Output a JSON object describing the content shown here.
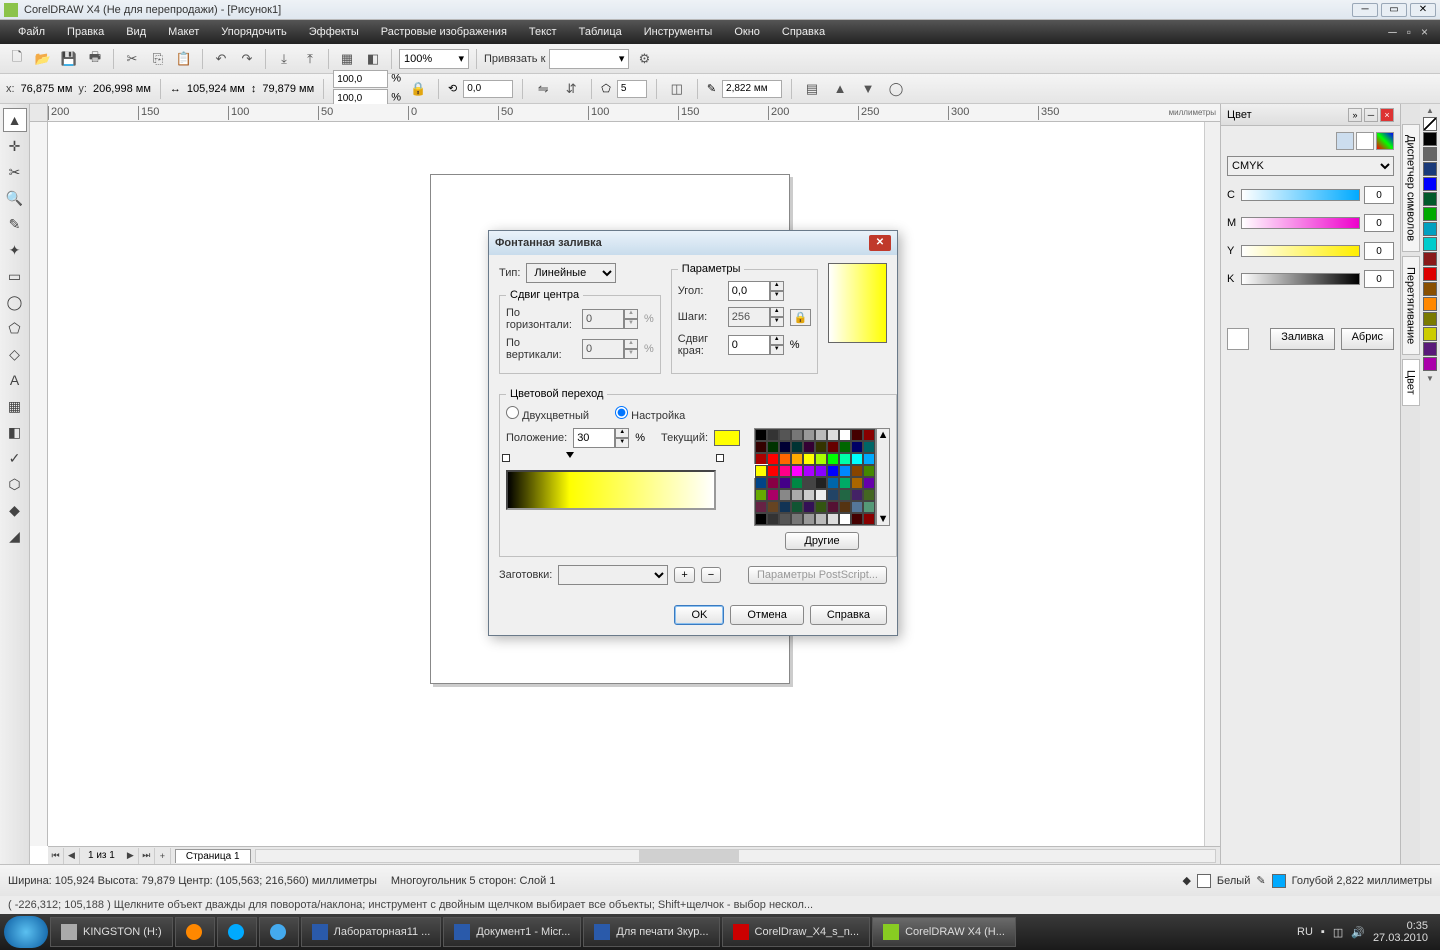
{
  "titlebar": {
    "text": "CorelDRAW X4 (Не для перепродажи) - [Рисунок1]"
  },
  "menu": [
    "Файл",
    "Правка",
    "Вид",
    "Макет",
    "Упорядочить",
    "Эффекты",
    "Растровые изображения",
    "Текст",
    "Таблица",
    "Инструменты",
    "Окно",
    "Справка"
  ],
  "toolbar": {
    "zoom": "100%",
    "snap_label": "Привязать к"
  },
  "propbar": {
    "x_lbl": "x:",
    "x": "76,875 мм",
    "y_lbl": "y:",
    "y": "206,998 мм",
    "w": "105,924 мм",
    "h": "79,879 мм",
    "sx": "100,0",
    "sy": "100,0",
    "pct": "%",
    "rot": "0,0",
    "sides": "5",
    "outline": "2,822 мм"
  },
  "ruler_units": "миллиметры",
  "ruler_h": [
    "200",
    "150",
    "100",
    "50",
    "0",
    "50",
    "100",
    "150",
    "200",
    "250",
    "300",
    "350"
  ],
  "pagenav": {
    "count": "1 из 1",
    "tab": "Страница 1"
  },
  "docker": {
    "title": "Цвет",
    "mode": "CMYK",
    "channels": [
      {
        "l": "C",
        "v": "0",
        "g": "linear-gradient(90deg,#fff,#0af)"
      },
      {
        "l": "M",
        "v": "0",
        "g": "linear-gradient(90deg,#fff,#e0c)"
      },
      {
        "l": "Y",
        "v": "0",
        "g": "linear-gradient(90deg,#fff,#fe0)"
      },
      {
        "l": "K",
        "v": "0",
        "g": "linear-gradient(90deg,#fff,#000)"
      }
    ],
    "fill_btn": "Заливка",
    "outline_btn": "Абрис",
    "side_tabs": [
      "Диспетчер символов",
      "Перетягивание",
      "Цвет"
    ]
  },
  "dialog": {
    "title": "Фонтанная заливка",
    "type_lbl": "Тип:",
    "type_val": "Линейные",
    "center_grp": "Сдвиг центра",
    "horiz_lbl": "По горизонтали:",
    "horiz_v": "0",
    "vert_lbl": "По вертикали:",
    "vert_v": "0",
    "params_grp": "Параметры",
    "angle_lbl": "Угол:",
    "angle_v": "0,0",
    "steps_lbl": "Шаги:",
    "steps_v": "256",
    "edge_lbl": "Сдвиг края:",
    "edge_v": "0",
    "pct": "%",
    "trans_grp": "Цветовой переход",
    "two_color": "Двухцветный",
    "custom": "Настройка",
    "pos_lbl": "Положение:",
    "pos_v": "30",
    "cur_lbl": "Текущий:",
    "others_btn": "Другие",
    "presets_lbl": "Заготовки:",
    "ps_btn": "Параметры PostScript...",
    "ok": "OK",
    "cancel": "Отмена",
    "help": "Справка"
  },
  "palette_right": [
    "#000",
    "#666",
    "#1a3a7a",
    "#00f",
    "#005a2a",
    "#0a0",
    "#00a0c0",
    "#0cc",
    "#8a1a1a",
    "#d00",
    "#8a5000",
    "#f80",
    "#7a7a00",
    "#cc0",
    "#5a1a7a",
    "#a0a"
  ],
  "status1": {
    "dims": "Ширина: 105,924 Высота: 79,879 Центр: (105,563; 216,560)  миллиметры",
    "obj": "Многоугольник  5 сторон: Слой 1",
    "fill_name": "Белый",
    "outline_name": "Голубой 2,822 миллиметры"
  },
  "status2": "( -226,312;  105,188 )     Щелкните объект дважды для поворота/наклона; инструмент с двойным щелчком выбирает все объекты; Shift+щелчок - выбор нескол...",
  "taskbar": {
    "items": [
      "KINGSTON (H:)",
      "",
      "",
      "",
      "Лабораторная11 ...",
      "Документ1 - Micr...",
      "Для печати 3кур...",
      "CorelDraw_X4_s_n...",
      "CorelDRAW X4 (Н..."
    ],
    "lang": "RU",
    "time": "0:35",
    "date": "27.03.2010"
  }
}
